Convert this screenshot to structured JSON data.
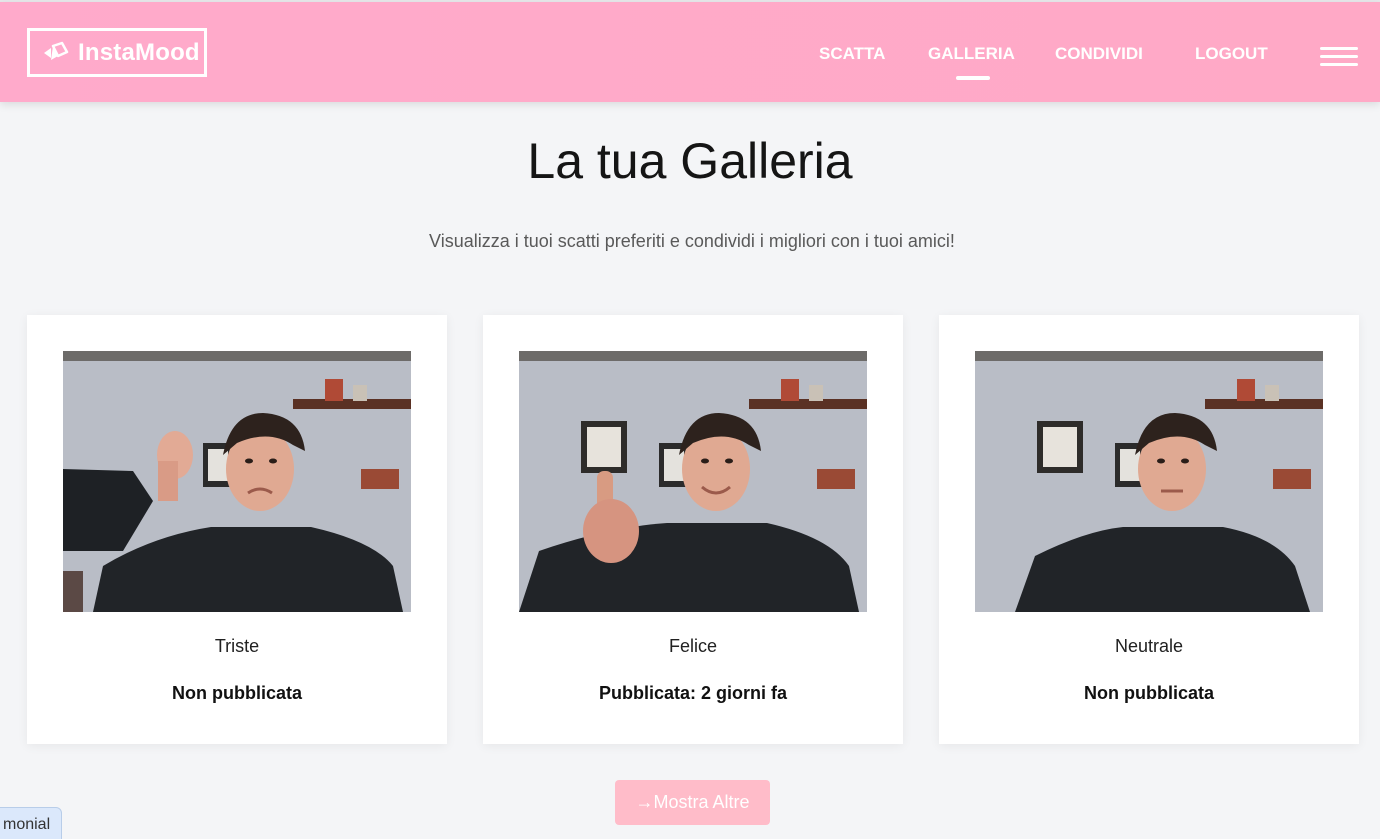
{
  "brand": {
    "name": "InstaMood"
  },
  "nav": {
    "links": [
      {
        "label": "SCATTA"
      },
      {
        "label": "GALLERIA",
        "active": true
      },
      {
        "label": "CONDIVIDI"
      },
      {
        "label": "LOGOUT"
      }
    ]
  },
  "page": {
    "title": "La tua Galleria",
    "subtitle": "Visualizza i tuoi scatti preferiti e condividi i migliori con i tuoi amici!"
  },
  "gallery": [
    {
      "mood": "Triste",
      "status": "Non pubblicata",
      "gesture": "thumbs-down"
    },
    {
      "mood": "Felice",
      "status": "Pubblicata: 2 giorni fa",
      "gesture": "thumbs-up"
    },
    {
      "mood": "Neutrale",
      "status": "Non pubblicata",
      "gesture": "none"
    }
  ],
  "more_button": {
    "label": "→Mostra Altre"
  },
  "side_tab": {
    "label": "monial"
  },
  "colors": {
    "navbar": "#ffaacb",
    "background": "#f4f5f7",
    "button": "#ffbcc9",
    "text": "#151515"
  },
  "icons": [
    "logo-icon",
    "hamburger-menu-icon",
    "arrow-right-icon"
  ]
}
